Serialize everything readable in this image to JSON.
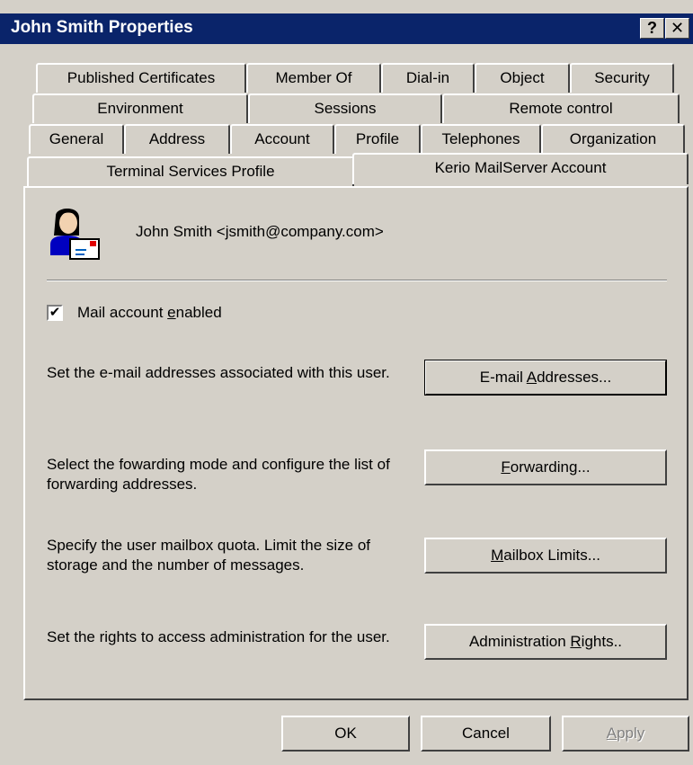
{
  "window": {
    "title": "John Smith Properties",
    "help_glyph": "?",
    "close_glyph": "✕"
  },
  "tabs": {
    "row1": [
      "Published Certificates",
      "Member Of",
      "Dial-in",
      "Object",
      "Security"
    ],
    "row2": [
      "Environment",
      "Sessions",
      "Remote control"
    ],
    "row3": [
      "General",
      "Address",
      "Account",
      "Profile",
      "Telephones",
      "Organization"
    ],
    "row4": [
      "Terminal Services Profile",
      "Kerio MailServer Account"
    ]
  },
  "active_tab": "Kerio MailServer Account",
  "user": {
    "display": "John Smith <jsmith@company.com>",
    "icon": "user-mail-icon"
  },
  "mail_account": {
    "label_pre": "Mail account ",
    "label_accel": "e",
    "label_post": "nabled",
    "checked": true
  },
  "sections": {
    "email": {
      "desc": "Set the e-mail addresses associated with this user.",
      "btn_pre": "E-mail ",
      "btn_accel": "A",
      "btn_post": "ddresses..."
    },
    "forwarding": {
      "desc": "Select the fowarding mode and configure the list of forwarding addresses.",
      "btn_pre": "",
      "btn_accel": "F",
      "btn_post": "orwarding..."
    },
    "mailbox": {
      "desc": "Specify the user mailbox quota. Limit the size of storage and the number of messages.",
      "btn_pre": "",
      "btn_accel": "M",
      "btn_post": "ailbox Limits..."
    },
    "admin": {
      "desc": "Set the rights to access administration for the user.",
      "btn_pre": "Administration ",
      "btn_accel": "R",
      "btn_post": "ights.."
    }
  },
  "footer": {
    "ok": "OK",
    "cancel": "Cancel",
    "apply_accel": "A",
    "apply_post": "pply"
  },
  "colors": {
    "titlebar": "#0a246a",
    "face": "#d4d0c8"
  }
}
